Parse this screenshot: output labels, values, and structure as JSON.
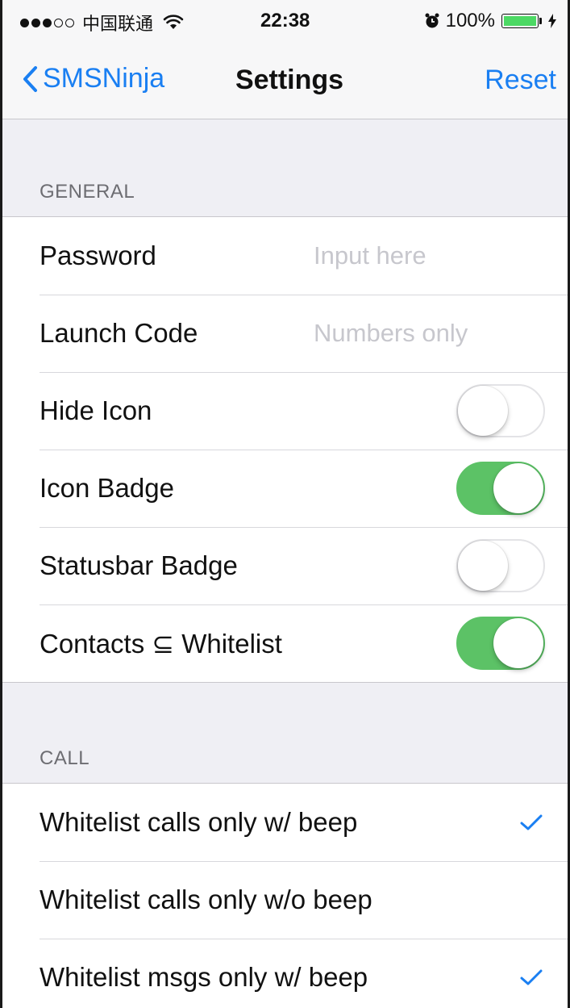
{
  "status_bar": {
    "carrier": "中国联通",
    "time": "22:38",
    "battery": "100%"
  },
  "nav": {
    "back_label": "SMSNinja",
    "title": "Settings",
    "reset_label": "Reset"
  },
  "general": {
    "header": "GENERAL",
    "password_label": "Password",
    "password_placeholder": "Input here",
    "launch_code_label": "Launch Code",
    "launch_code_placeholder": "Numbers only",
    "hide_icon_label": "Hide Icon",
    "hide_icon_on": false,
    "icon_badge_label": "Icon Badge",
    "icon_badge_on": true,
    "statusbar_badge_label": "Statusbar Badge",
    "statusbar_badge_on": false,
    "contacts_whitelist_label": "Contacts ⊆ Whitelist",
    "contacts_whitelist_on": true
  },
  "call": {
    "header": "CALL",
    "items": [
      {
        "label": "Whitelist calls only w/ beep",
        "checked": true
      },
      {
        "label": "Whitelist calls only w/o beep",
        "checked": false
      },
      {
        "label": "Whitelist msgs only w/ beep",
        "checked": true
      }
    ]
  },
  "colors": {
    "accent": "#1a7ff2",
    "toggle_on": "#5cc266"
  }
}
